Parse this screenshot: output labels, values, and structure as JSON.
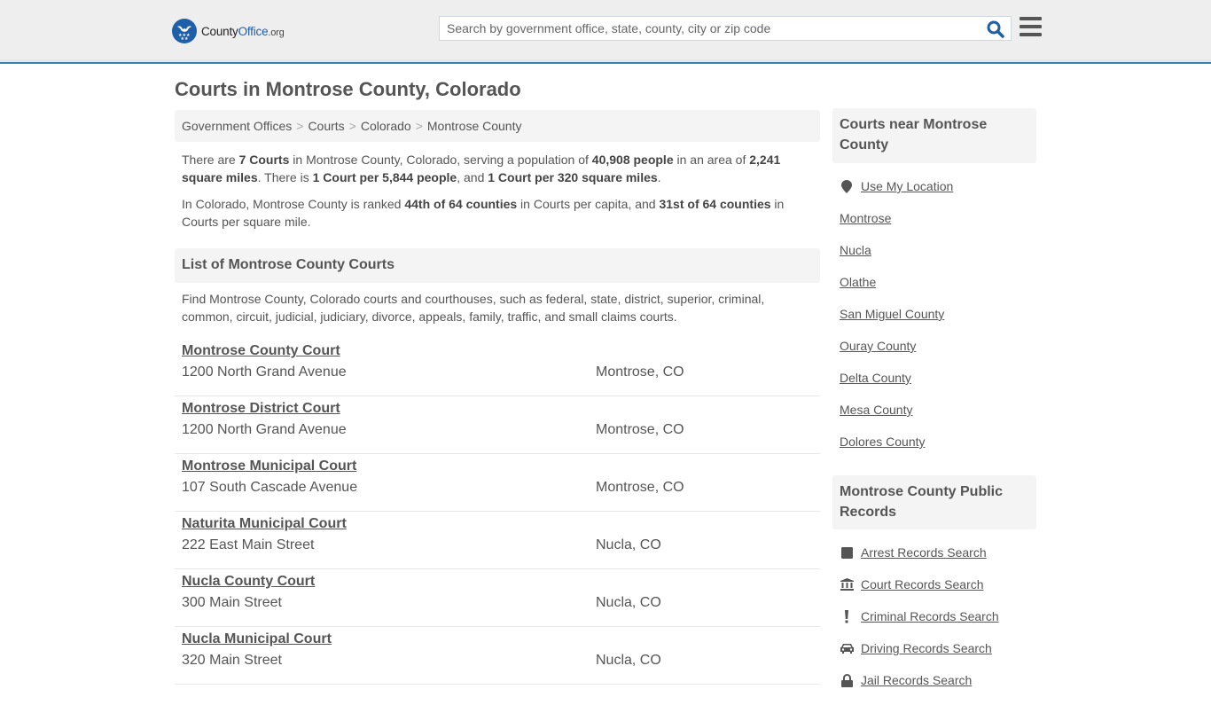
{
  "header": {
    "logo": {
      "brand_county": "County",
      "brand_office": "Office",
      "brand_tld": ".org"
    },
    "search": {
      "placeholder": "Search by government office, state, county, city or zip code",
      "value": ""
    },
    "colors": {
      "accent": "#1f5ea8",
      "header_border": "#3a7fb0",
      "header_bg": "#eeeeee"
    }
  },
  "page": {
    "title": "Courts in Montrose County, Colorado",
    "breadcrumb": [
      {
        "label": "Government Offices"
      },
      {
        "label": "Courts"
      },
      {
        "label": "Colorado"
      },
      {
        "label": "Montrose County"
      }
    ],
    "breadcrumb_separator": ">",
    "intro": {
      "p1": {
        "t1": "There are ",
        "b1": "7 Courts",
        "t2": " in Montrose County, Colorado, serving a population of ",
        "b2": "40,908 people",
        "t3": " in an area of ",
        "b3": "2,241 square miles",
        "t4": ". There is ",
        "b4": "1 Court per 5,844 people",
        "t5": ", and ",
        "b5": "1 Court per 320 square miles",
        "t6": "."
      },
      "p2": {
        "t1": "In Colorado, Montrose County is ranked ",
        "b1": "44th of 64 counties",
        "t2": " in Courts per capita, and ",
        "b2": "31st of 64 counties",
        "t3": " in Courts per square mile."
      }
    },
    "list_heading": "List of Montrose County Courts",
    "list_description": "Find Montrose County, Colorado courts and courthouses, such as federal, state, district, superior, criminal, common, circuit, judicial, judiciary, divorce, appeals, family, traffic, and small claims courts.",
    "courts": [
      {
        "name": "Montrose County Court",
        "address": "1200 North Grand Avenue",
        "city": "Montrose, CO"
      },
      {
        "name": "Montrose District Court",
        "address": "1200 North Grand Avenue",
        "city": "Montrose, CO"
      },
      {
        "name": "Montrose Municipal Court",
        "address": "107 South Cascade Avenue",
        "city": "Montrose, CO"
      },
      {
        "name": "Naturita Municipal Court",
        "address": "222 East Main Street",
        "city": "Nucla, CO"
      },
      {
        "name": "Nucla County Court",
        "address": "300 Main Street",
        "city": "Nucla, CO"
      },
      {
        "name": "Nucla Municipal Court",
        "address": "320 Main Street",
        "city": "Nucla, CO"
      }
    ]
  },
  "sidebar": {
    "nearby": {
      "heading": "Courts near Montrose County",
      "use_location": {
        "label": "Use My Location",
        "icon": "map-marker-icon"
      },
      "links": [
        {
          "label": "Montrose"
        },
        {
          "label": "Nucla"
        },
        {
          "label": "Olathe"
        },
        {
          "label": "San Miguel County"
        },
        {
          "label": "Ouray County"
        },
        {
          "label": "Delta County"
        },
        {
          "label": "Mesa County"
        },
        {
          "label": "Dolores County"
        }
      ]
    },
    "records": {
      "heading": "Montrose County Public Records",
      "links": [
        {
          "label": "Arrest Records Search",
          "icon": "square-icon"
        },
        {
          "label": "Court Records Search",
          "icon": "courthouse-icon"
        },
        {
          "label": "Criminal Records Search",
          "icon": "exclamation-icon"
        },
        {
          "label": "Driving Records Search",
          "icon": "car-icon"
        },
        {
          "label": "Jail Records Search",
          "icon": "lock-icon"
        }
      ]
    }
  }
}
